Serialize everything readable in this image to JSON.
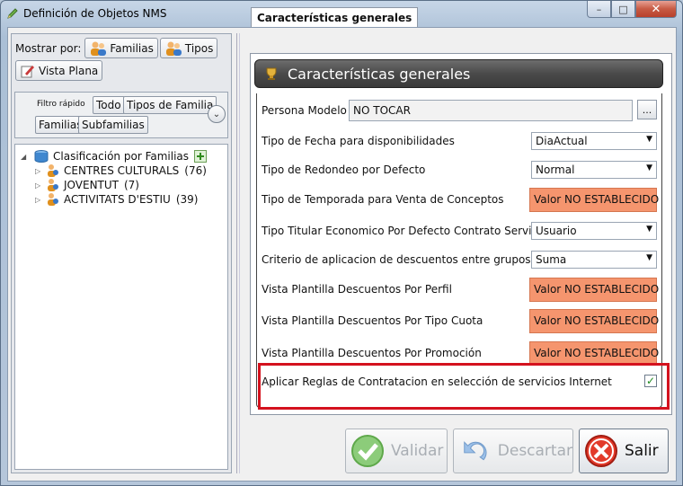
{
  "window": {
    "title": "Definición de Objetos NMS",
    "buttons": {
      "minimize": "–",
      "maximize": "□",
      "close": "✕"
    }
  },
  "left": {
    "mostrar_label": "Mostrar por:",
    "mostrar_buttons": [
      "Familias",
      "Tipos",
      "Vista Plana"
    ],
    "filtro_label": "Filtro rápido",
    "filtro_buttons": [
      "Todo",
      "Tipos de Familia",
      "Familias",
      "Subfamilias"
    ],
    "tree": {
      "root": "Clasificación por Familias",
      "items": [
        {
          "name": "CENTRES CULTURALS",
          "count": "(76)"
        },
        {
          "name": "JOVENTUT",
          "count": "(7)"
        },
        {
          "name": "ACTIVITATS D'ESTIU",
          "count": "(39)"
        }
      ]
    }
  },
  "tab": {
    "label": "Características generales"
  },
  "section": {
    "title": "Características generales"
  },
  "props": [
    {
      "label": "Persona Modelo",
      "value": "NO TOCAR",
      "kind": "text"
    },
    {
      "label": "Tipo de Fecha para disponibilidades",
      "value": "DiaActual",
      "kind": "combo"
    },
    {
      "label": "Tipo de Redondeo por Defecto",
      "value": "Normal",
      "kind": "combo"
    },
    {
      "label": "Tipo de Temporada para Venta de Conceptos",
      "value": "Valor NO ESTABLECIDO",
      "kind": "warn"
    },
    {
      "label": "Tipo Titular Economico Por Defecto Contrato Servicio",
      "value": "Usuario",
      "kind": "combo"
    },
    {
      "label": "Criterio de aplicacion de descuentos entre grupos",
      "value": "Suma",
      "kind": "combo"
    },
    {
      "label": "Vista Plantilla Descuentos Por Perfil",
      "value": "Valor NO ESTABLECIDO",
      "kind": "warn"
    },
    {
      "label": "Vista Plantilla Descuentos Por Tipo Cuota",
      "value": "Valor NO ESTABLECIDO",
      "kind": "warn"
    },
    {
      "label": "Vista Plantilla Descuentos Por Promoción",
      "value": "Valor NO ESTABLECIDO",
      "kind": "warn"
    },
    {
      "label": "Aplicar Reglas de Contratacion en selección de servicios Internet",
      "value": "✓",
      "kind": "check"
    }
  ],
  "ellipsis": "...",
  "actions": {
    "validar": "Validar",
    "descartar": "Descartar",
    "salir": "Salir"
  },
  "colors": {
    "warn": "#f5956e",
    "highlight": "#d4121e"
  }
}
